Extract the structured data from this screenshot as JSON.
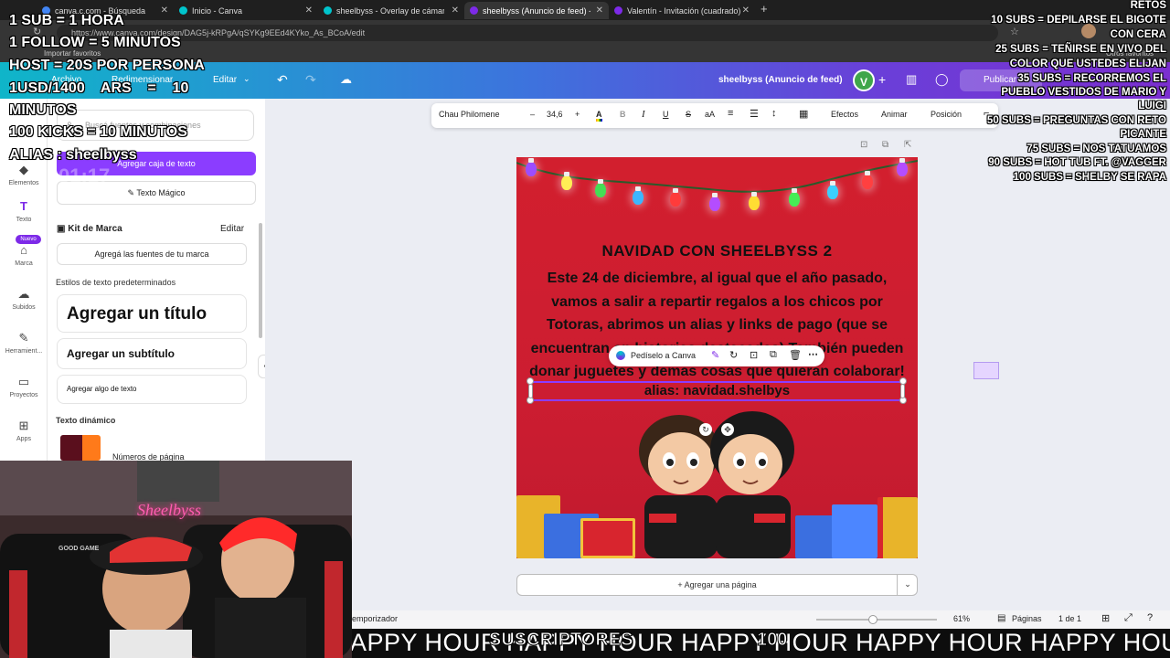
{
  "browser": {
    "tabs": [
      {
        "title": "canva.c.com - Búsqueda",
        "fav": "#4285f4"
      },
      {
        "title": "Inicio - Canva",
        "fav": "#00c4cc"
      },
      {
        "title": "sheelbyss - Overlay de cámara web",
        "fav": "#00c4cc"
      },
      {
        "title": "sheelbyss (Anuncio de feed) - Anuncio",
        "fav": "#7d2ae8"
      },
      {
        "title": "Valentín - Invitación (cuadrado)",
        "fav": "#7d2ae8"
      }
    ],
    "new_tab": "+",
    "url": "https://www.canva.com/design/DAG5j-kRPgA/qSYKg9EEd4KYko_As_BCoA/edit",
    "bookmarks": {
      "import": "Importar favoritos",
      "others": "Otros favoritos"
    }
  },
  "canva": {
    "menu_file": "Archivo",
    "menu_resize": "Redimensionar",
    "menu_edit": "Editar",
    "doc_title": "sheelbyss (Anuncio de feed)",
    "avatar_letter": "V",
    "publish": "Publicar en"
  },
  "rail": [
    {
      "icon": "◆",
      "label": "Elementos"
    },
    {
      "icon": "T",
      "label": "Texto"
    },
    {
      "icon": "⌂",
      "label": "Marca"
    },
    {
      "icon": "☁",
      "label": "Subidos"
    },
    {
      "icon": "✎",
      "label": "Herramient..."
    },
    {
      "icon": "▭",
      "label": "Proyectos"
    },
    {
      "icon": "⊞",
      "label": "Apps"
    }
  ],
  "rail_badge": "Nuevo",
  "panel": {
    "search_placeholder": "Buscá fuentes y combinaciones",
    "add_textbox": "Agregar caja de texto",
    "magic_text": "Texto Mágico",
    "brand_kit": "Kit de Marca",
    "brand_kit_edit": "Editar",
    "brand_fonts": "Agregá las fuentes de tu marca",
    "default_styles": "Estilos de texto predeterminados",
    "add_title": "Agregar un título",
    "add_subtitle": "Agregar un subtítulo",
    "add_body": "Agregar algo de texto",
    "dynamic_text": "Texto dinámico",
    "page_numbers": "Números de página"
  },
  "toolbar": {
    "font": "Chau Philomene",
    "minus": "–",
    "size": "34,6",
    "plus": "+",
    "bold": "B",
    "italic": "I",
    "underline": "U",
    "strike": "S",
    "case": "aA",
    "effects": "Efectos",
    "animate": "Animar",
    "position": "Posición"
  },
  "poster": {
    "title": "NAVIDAD CON SHEELBYSS 2",
    "body": "Este 24 de diciembre, al igual que el año pasado, vamos a salir a repartir regalos a los chicos por Totoras, abrimos un alias y links de pago (que se encuentran en historias destacadas) También pueden donar juguetes y demas cosas que quieran colaborar!",
    "alias": "alias: navidad.shelbys"
  },
  "context_menu": {
    "ask": "Pedíselo a Canva"
  },
  "add_page": "+ Agregar una página",
  "footer": {
    "timer_label": "emporizador",
    "zoom": "61%",
    "pages_label": "Páginas",
    "page_count": "1 de 1"
  },
  "ticker": {
    "text": "APPY HOUR HAPPY HOUR HAPPY HOUR HAPPY HOUR HAPPY HOUR",
    "subs_label": "SUSCRIPTORES",
    "subs_count": "100"
  },
  "stream_overlay_left": [
    "1 SUB = 1 HORA",
    "1 FOLLOW  = 5 MINUTOS",
    "HOST = 20S POR PERSONA",
    "1USD/1400    ARS    =    10",
    "MINUTOS",
    "100 KICKS = 10 MINUTOS",
    "ALIAS : sheelbyss"
  ],
  "stream_timer": "01:17",
  "stream_overlay_right": [
    "RETOS",
    "10 SUBS = DEPILARSE EL BIGOTE",
    "CON CERA",
    "25 SUBS = TEÑIRSE EN VIVO DEL",
    "COLOR QUE USTEDES ELIJAN",
    "35 SUBS = RECORREMOS EL",
    "PUEBLO VESTIDOS DE MARIO Y",
    "LUIGI",
    "50 SUBS = PREGUNTAS CON RETO",
    "PICANTE",
    "75 SUBS = NOS TATUAMOS",
    "90 SUBS  = HOT TUB FT. @VAGGER",
    "100 SUBS = SHELBY SE RAPA"
  ],
  "webcam": {
    "neon_sign": "Sheelbyss",
    "chair_text": "GOOD GAME"
  },
  "colors": {
    "canva_purple": "#8b3dff",
    "poster_red": "#d21f2e",
    "header_start": "#0fb5c9",
    "header_end": "#7b2fd0"
  }
}
